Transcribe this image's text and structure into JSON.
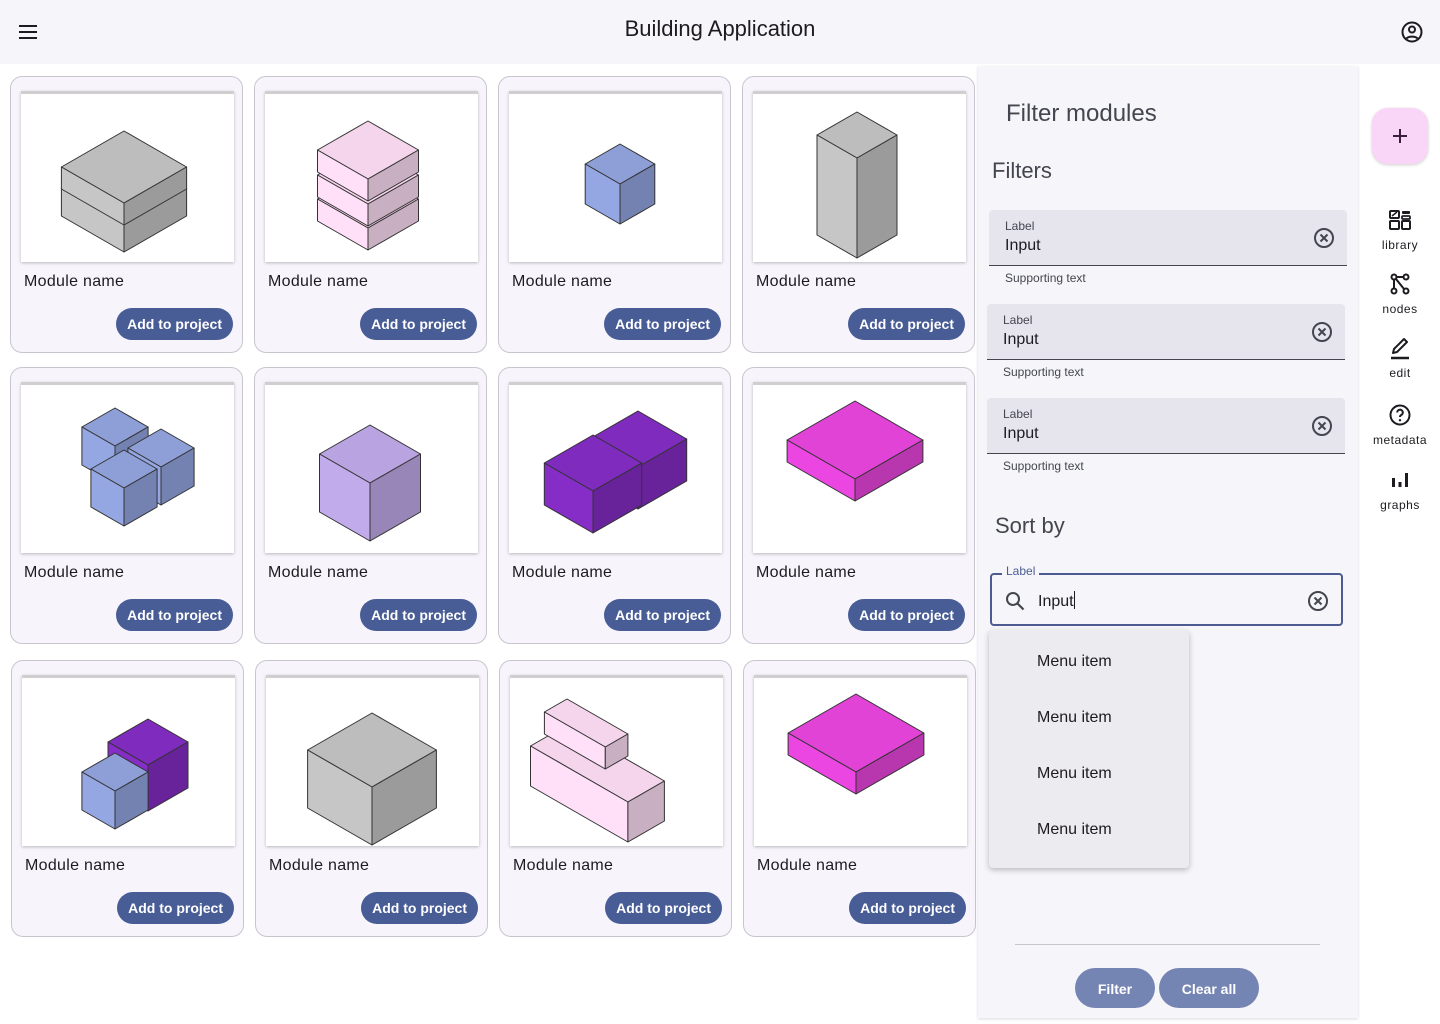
{
  "header": {
    "title": "Building Application",
    "menu_icon": "menu-icon",
    "account_icon": "account-circle-icon"
  },
  "modules": [
    {
      "name": "Module name",
      "button": "Add to project",
      "shape": "stacked-slabs-gray"
    },
    {
      "name": "Module name",
      "button": "Add to project",
      "shape": "stacked-boxes-pink"
    },
    {
      "name": "Module name",
      "button": "Add to project",
      "shape": "small-cube-blue"
    },
    {
      "name": "Module name",
      "button": "Add to project",
      "shape": "tall-tower-gray"
    },
    {
      "name": "Module name",
      "button": "Add to project",
      "shape": "cube-cluster-blue"
    },
    {
      "name": "Module name",
      "button": "Add to project",
      "shape": "cube-lavender"
    },
    {
      "name": "Module name",
      "button": "Add to project",
      "shape": "double-cube-purple"
    },
    {
      "name": "Module name",
      "button": "Add to project",
      "shape": "flat-slab-magenta"
    },
    {
      "name": "Module name",
      "button": "Add to project",
      "shape": "cube-pair-purple-blue"
    },
    {
      "name": "Module name",
      "button": "Add to project",
      "shape": "cube-gray"
    },
    {
      "name": "Module name",
      "button": "Add to project",
      "shape": "stepped-block-pink"
    },
    {
      "name": "Module name",
      "button": "Add to project",
      "shape": "flat-slab-magenta"
    }
  ],
  "filter_panel": {
    "title": "Filter modules",
    "filters_heading": "Filters",
    "fields": [
      {
        "label": "Label",
        "value": "Input",
        "supporting": "Supporting text"
      },
      {
        "label": "Label",
        "value": "Input",
        "supporting": "Supporting text"
      },
      {
        "label": "Label",
        "value": "Input",
        "supporting": "Supporting text"
      }
    ],
    "sort_heading": "Sort by",
    "sort_field": {
      "label": "Label",
      "value": "Input"
    },
    "menu_items": [
      "Menu item",
      "Menu item",
      "Menu item",
      "Menu item"
    ],
    "filter_button": "Filter",
    "clear_button": "Clear all"
  },
  "rail": {
    "fab_icon": "add-icon",
    "items": [
      {
        "label": "library",
        "icon": "library-icon"
      },
      {
        "label": "nodes",
        "icon": "nodes-icon"
      },
      {
        "label": "edit",
        "icon": "edit-icon"
      },
      {
        "label": "metadata",
        "icon": "help-icon"
      },
      {
        "label": "graphs",
        "icon": "bar-chart-icon"
      }
    ]
  },
  "colors": {
    "primary": "#485c96",
    "filter_button": "#7585b3",
    "fab": "#f9d5f7",
    "gray": "#bdbdbd",
    "pink": "#f5d5ec",
    "blue": "#8e9fd8",
    "lavender": "#b9a3e0",
    "purple": "#7f2bbd",
    "magenta": "#e043d6"
  }
}
